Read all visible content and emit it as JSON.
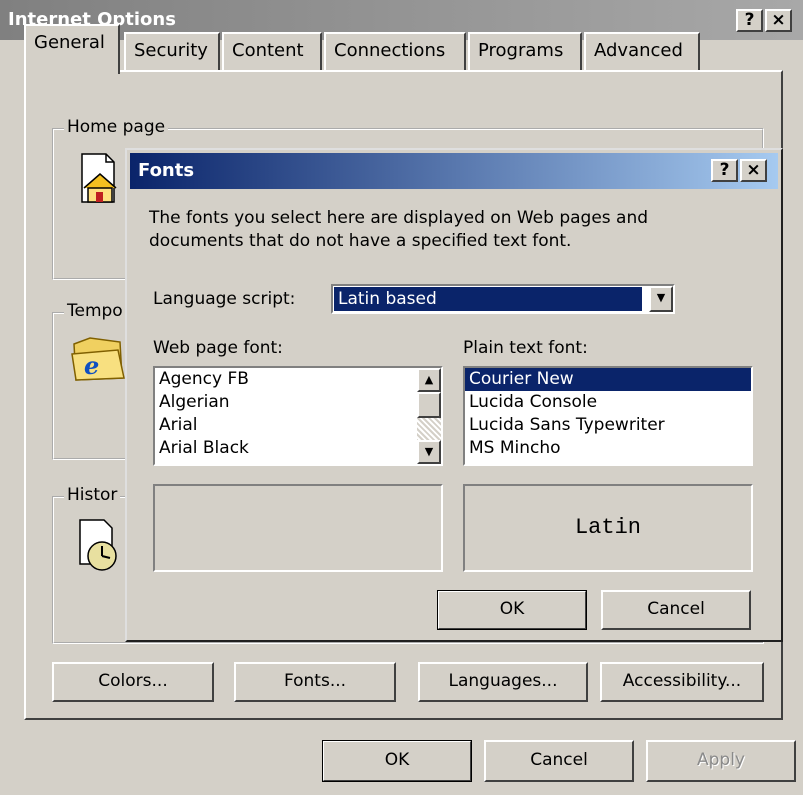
{
  "window": {
    "title": "Internet Options",
    "help_label": "?",
    "close_label": "×"
  },
  "tabs": [
    {
      "label": "General"
    },
    {
      "label": "Security"
    },
    {
      "label": "Content"
    },
    {
      "label": "Connections"
    },
    {
      "label": "Programs"
    },
    {
      "label": "Advanced"
    }
  ],
  "groups": {
    "home": "Home page",
    "temp": "Tempo",
    "history": "Histor"
  },
  "general_buttons": {
    "colors": "Colors...",
    "fonts": "Fonts...",
    "languages": "Languages...",
    "accessibility": "Accessibility..."
  },
  "bottom_buttons": {
    "ok": "OK",
    "cancel": "Cancel",
    "apply": "Apply"
  },
  "fonts_dialog": {
    "title": "Fonts",
    "help_label": "?",
    "close_label": "×",
    "description_line1": "The fonts you select here are displayed on Web pages and",
    "description_line2": "documents that do not have a specified text font.",
    "language_script_label": "Language script:",
    "language_script_value": "Latin based",
    "web_font_label": "Web page font:",
    "web_fonts": [
      "Agency FB",
      "Algerian",
      "Arial",
      "Arial Black"
    ],
    "plain_font_label": "Plain text font:",
    "plain_fonts": [
      "Courier New",
      "Lucida Console",
      "Lucida Sans Typewriter",
      "MS Mincho"
    ],
    "plain_selected": "Courier New",
    "plain_preview": "Latin",
    "ok": "OK",
    "cancel": "Cancel"
  },
  "colors": {
    "dialog_title_start": "#0a246a",
    "dialog_title_end": "#a6caf0",
    "inactive_title": "#808080",
    "face": "#d4d0c8",
    "selection": "#0a246a"
  }
}
